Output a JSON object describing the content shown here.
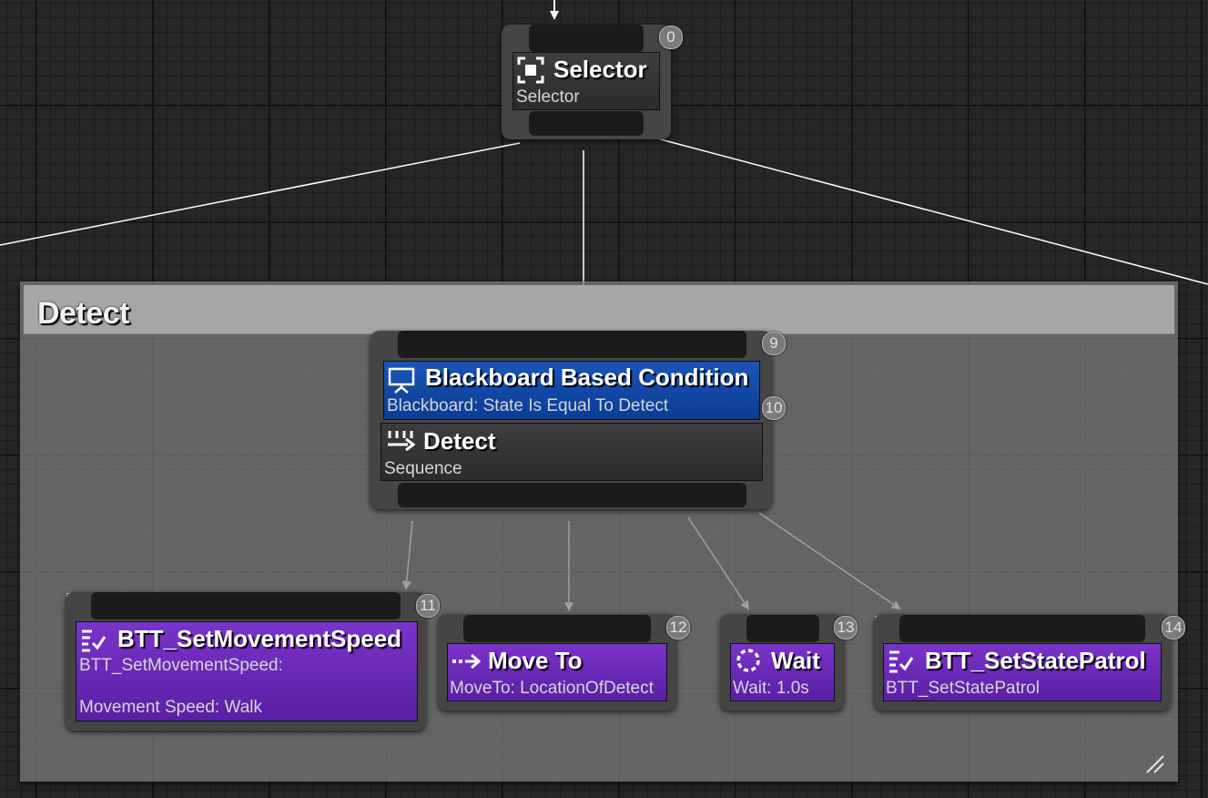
{
  "graph": {
    "comment_box": {
      "title": "Detect"
    },
    "nodes": {
      "selector": {
        "index": "0",
        "title": "Selector",
        "subtitle": "Selector",
        "icon": "selector-icon"
      },
      "detect": {
        "index": "9",
        "decorator": {
          "index": "10",
          "title": "Blackboard Based Condition",
          "subtitle": "Blackboard: State Is Equal To Detect",
          "icon": "blackboard-icon",
          "color": "#0c43a2"
        },
        "title": "Detect",
        "subtitle": "Sequence",
        "icon": "sequence-icon"
      },
      "set_movement_speed": {
        "index": "11",
        "title": "BTT_SetMovementSpeed",
        "subtitle_line1": "BTT_SetMovementSpeed:",
        "subtitle_line2": "Movement Speed: Walk",
        "icon": "task-icon",
        "color": "#6a28b8"
      },
      "move_to": {
        "index": "12",
        "title": "Move To",
        "subtitle": "MoveTo: LocationOfDetect",
        "icon": "move-to-icon",
        "color": "#6a28b8"
      },
      "wait": {
        "index": "13",
        "title": "Wait",
        "subtitle": "Wait: 1.0s",
        "icon": "wait-icon",
        "color": "#6a28b8"
      },
      "set_state_patrol": {
        "index": "14",
        "title": "BTT_SetStatePatrol",
        "subtitle": "BTT_SetStatePatrol",
        "icon": "task-icon",
        "color": "#6a28b8"
      }
    }
  },
  "colors": {
    "canvas": "#262626",
    "task_purple": "#6a28b8",
    "decorator_blue": "#0c43a2",
    "wire": "#ffffff"
  }
}
